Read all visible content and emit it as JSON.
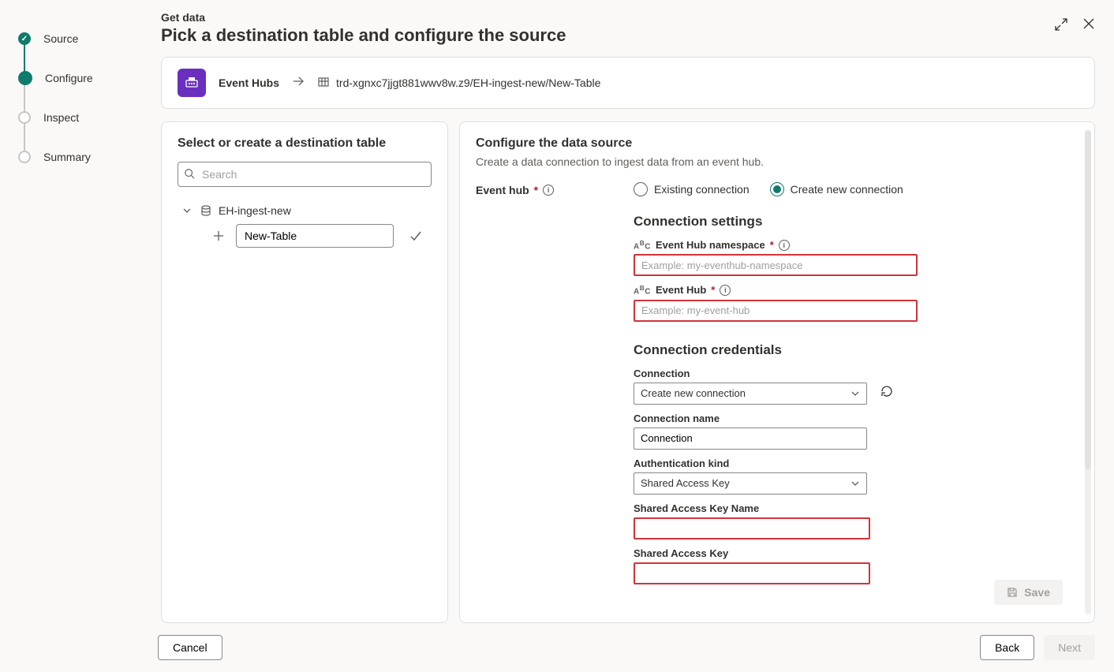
{
  "stepper": {
    "items": [
      {
        "label": "Source",
        "state": "done"
      },
      {
        "label": "Configure",
        "state": "current"
      },
      {
        "label": "Inspect",
        "state": "future"
      },
      {
        "label": "Summary",
        "state": "future"
      }
    ]
  },
  "header": {
    "eyebrow": "Get data",
    "title": "Pick a destination table and configure the source"
  },
  "breadcrumb": {
    "source": "Event Hubs",
    "path": "trd-xgnxc7jjgt881wwv8w.z9/EH-ingest-new/New-Table"
  },
  "leftPanel": {
    "title": "Select or create a destination table",
    "searchPlaceholder": "Search",
    "tree": {
      "parent": "EH-ingest-new",
      "newTable": "New-Table"
    }
  },
  "rightPanel": {
    "title": "Configure the data source",
    "subtitle": "Create a data connection to ingest data from an event hub.",
    "eventHubLabel": "Event hub",
    "radios": {
      "existing": "Existing connection",
      "create": "Create new connection"
    },
    "sections": {
      "conn": "Connection settings",
      "cred": "Connection credentials"
    },
    "fields": {
      "ns": {
        "label": "Event Hub namespace",
        "ph": "Example: my-eventhub-namespace"
      },
      "eh": {
        "label": "Event Hub",
        "ph": "Example: my-event-hub"
      },
      "connection": {
        "label": "Connection",
        "value": "Create new connection"
      },
      "connName": {
        "label": "Connection name",
        "value": "Connection"
      },
      "authKind": {
        "label": "Authentication kind",
        "value": "Shared Access Key"
      },
      "sakName": {
        "label": "Shared Access Key Name"
      },
      "sak": {
        "label": "Shared Access Key"
      }
    },
    "saveBtn": "Save"
  },
  "footer": {
    "cancel": "Cancel",
    "back": "Back",
    "next": "Next"
  }
}
